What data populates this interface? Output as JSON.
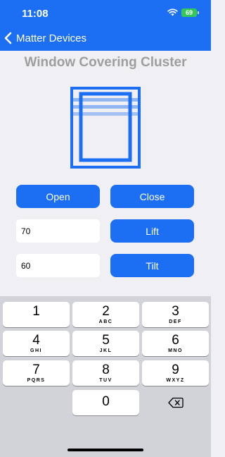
{
  "status_bar": {
    "time": "11:08",
    "battery": "69"
  },
  "nav": {
    "back_label": "Matter Devices"
  },
  "title": "Window Covering Cluster",
  "colors": {
    "accent": "#1c6ef2",
    "title_gray": "#9e9e9e",
    "battery_green": "#34c759",
    "keyboard_bg": "#d1d3d9"
  },
  "buttons": {
    "open": "Open",
    "close": "Close",
    "lift": "Lift",
    "tilt": "Tilt"
  },
  "inputs": {
    "lift_value": "70",
    "tilt_value": "60"
  },
  "icons": {
    "back": "chevron-left-icon",
    "wifi": "wifi-icon",
    "window": "window-covering-icon",
    "delete": "delete-backspace-icon"
  },
  "keyboard": {
    "keys": [
      {
        "num": "1",
        "letters": ""
      },
      {
        "num": "2",
        "letters": "ABC"
      },
      {
        "num": "3",
        "letters": "DEF"
      },
      {
        "num": "4",
        "letters": "GHI"
      },
      {
        "num": "5",
        "letters": "JKL"
      },
      {
        "num": "6",
        "letters": "MNO"
      },
      {
        "num": "7",
        "letters": "PQRS"
      },
      {
        "num": "8",
        "letters": "TUV"
      },
      {
        "num": "9",
        "letters": "WXYZ"
      },
      {
        "num": "0",
        "letters": ""
      }
    ]
  }
}
